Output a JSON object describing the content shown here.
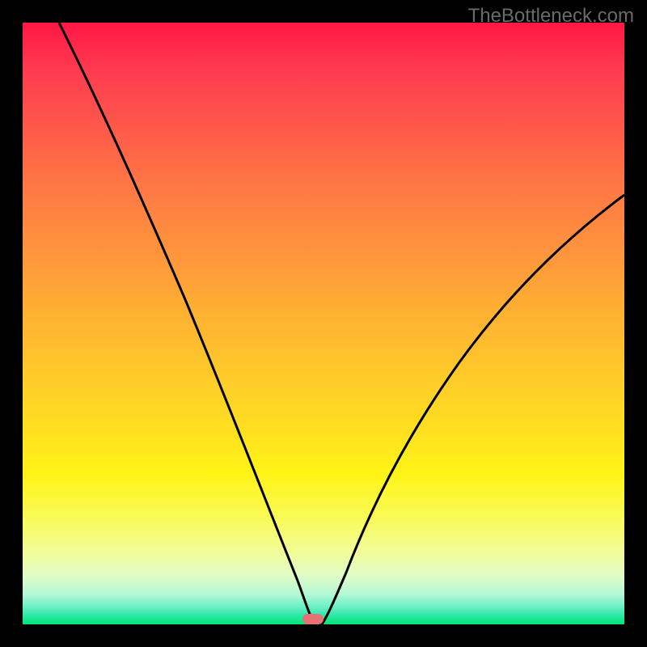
{
  "watermark": "TheBottleneck.com",
  "chart_data": {
    "type": "line",
    "title": "",
    "xlabel": "",
    "ylabel": "",
    "xlim": [
      0,
      100
    ],
    "ylim": [
      0,
      100
    ],
    "background_gradient": {
      "top": "#ff1744",
      "middle": "#ffeb3b",
      "bottom": "#00e676"
    },
    "series": [
      {
        "name": "bottleneck-curve",
        "color": "#000000",
        "x": [
          6,
          10,
          15,
          20,
          25,
          30,
          35,
          40,
          45,
          48,
          50,
          52,
          55,
          60,
          65,
          70,
          75,
          80,
          85,
          90,
          95,
          100
        ],
        "y": [
          100,
          90,
          79,
          68,
          57,
          46,
          35,
          24,
          10,
          2,
          0,
          2,
          8,
          18,
          27,
          35,
          42,
          49,
          55,
          61,
          66,
          71
        ]
      }
    ],
    "marker": {
      "x": 50,
      "y": 0,
      "color": "#e57373",
      "shape": "rounded-rect"
    }
  }
}
